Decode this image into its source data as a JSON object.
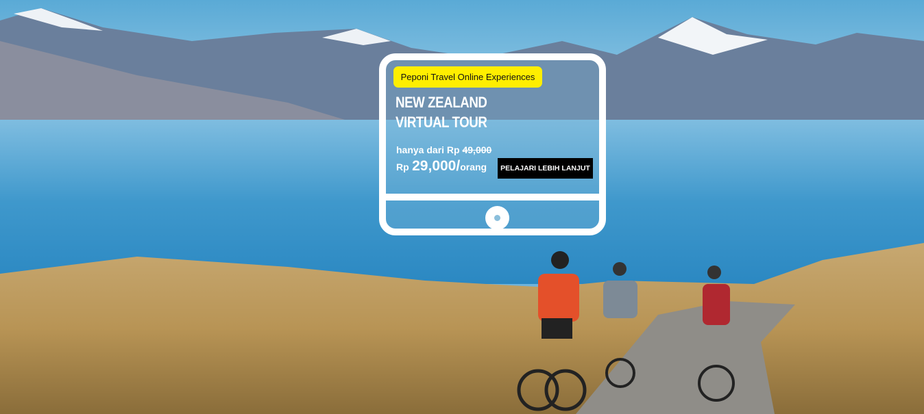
{
  "banner": {
    "badge": "Peponi Travel Online Experiences",
    "title_line1": "NEW ZEALAND",
    "title_line2": "VIRTUAL TOUR",
    "price_prefix": "hanya dari Rp",
    "old_price": "49,000",
    "currency": "Rp",
    "price": "29,000/",
    "per": "orang",
    "cta_label": "PELAJARI LEBIH LANJUT",
    "colors": {
      "badge": "#ffee00",
      "cta": "#000000",
      "frame": "#ffffff"
    }
  }
}
